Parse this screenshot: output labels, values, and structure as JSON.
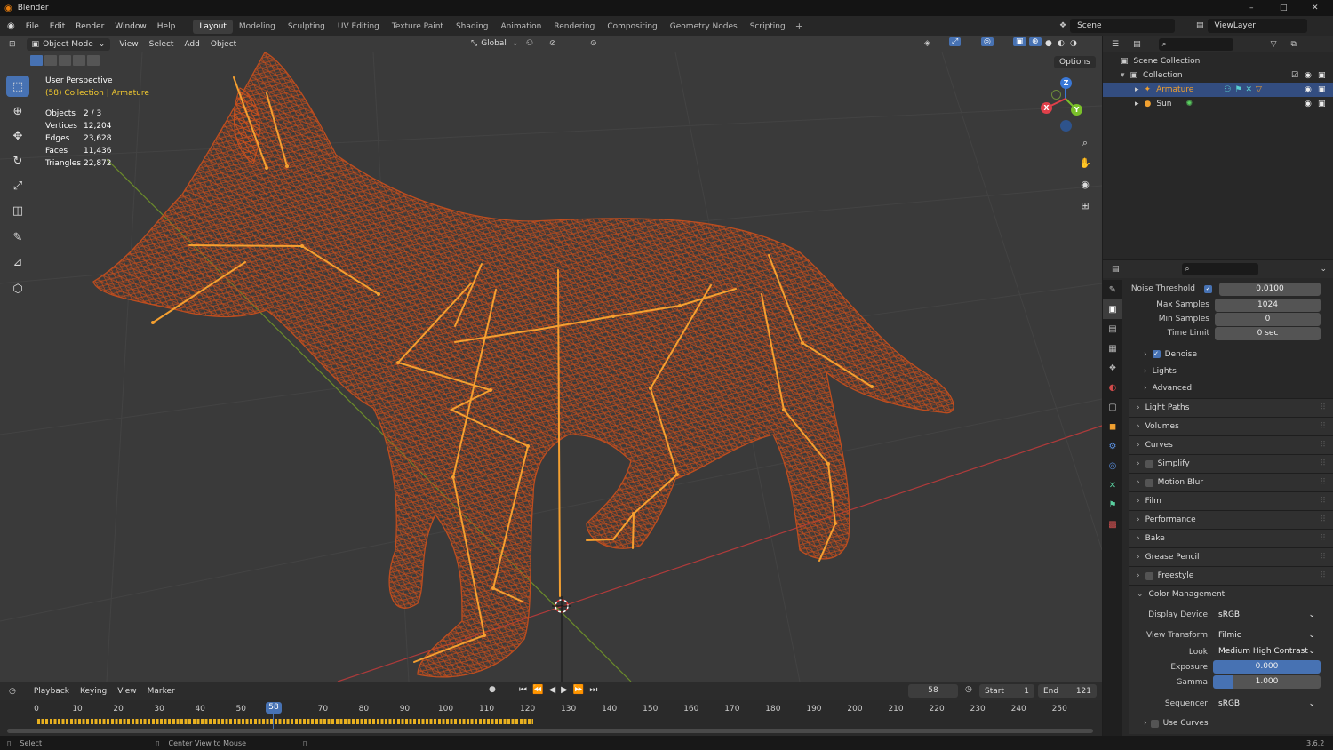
{
  "window": {
    "title": "Blender",
    "minimize": "–",
    "maximize": "□",
    "close": "✕"
  },
  "menu": [
    "File",
    "Edit",
    "Render",
    "Window",
    "Help"
  ],
  "workspaces": [
    "Layout",
    "Modeling",
    "Sculpting",
    "UV Editing",
    "Texture Paint",
    "Shading",
    "Animation",
    "Rendering",
    "Compositing",
    "Geometry Nodes",
    "Scripting"
  ],
  "active_workspace": "Layout",
  "add_workspace": "+",
  "scene": {
    "label": "Scene",
    "view_layer": "ViewLayer"
  },
  "viewport_header": {
    "mode": "Object Mode",
    "menus": [
      "View",
      "Select",
      "Add",
      "Object"
    ],
    "orientation": "Global",
    "options": "Options"
  },
  "viewport_info": {
    "perspective": "User Perspective",
    "collection": "(58) Collection | Armature",
    "stats": [
      {
        "label": "Objects",
        "value": "2 / 3"
      },
      {
        "label": "Vertices",
        "value": "12,204"
      },
      {
        "label": "Edges",
        "value": "23,628"
      },
      {
        "label": "Faces",
        "value": "11,436"
      },
      {
        "label": "Triangles",
        "value": "22,872"
      }
    ]
  },
  "gizmo": {
    "z": "Z",
    "y": "Y",
    "x": "X"
  },
  "outliner": {
    "root": "Scene Collection",
    "collection": "Collection",
    "items": [
      {
        "name": "Armature",
        "selected": true
      },
      {
        "name": "Sun",
        "selected": false
      }
    ]
  },
  "properties": {
    "sampling": [
      {
        "label": "Noise Threshold",
        "value": "0.0100",
        "checked": true
      },
      {
        "label": "Max Samples",
        "value": "1024"
      },
      {
        "label": "Min Samples",
        "value": "0"
      },
      {
        "label": "Time Limit",
        "value": "0 sec"
      }
    ],
    "sub_panels": [
      {
        "label": "Denoise",
        "checkbox": true,
        "checked": true
      },
      {
        "label": "Lights",
        "checkbox": false
      },
      {
        "label": "Advanced",
        "checkbox": false
      }
    ],
    "panels": [
      {
        "label": "Light Paths",
        "checkbox": false
      },
      {
        "label": "Volumes",
        "checkbox": false
      },
      {
        "label": "Curves",
        "checkbox": false
      },
      {
        "label": "Simplify",
        "checkbox": true
      },
      {
        "label": "Motion Blur",
        "checkbox": true
      },
      {
        "label": "Film",
        "checkbox": false
      },
      {
        "label": "Performance",
        "checkbox": false
      },
      {
        "label": "Bake",
        "checkbox": false
      },
      {
        "label": "Grease Pencil",
        "checkbox": false
      },
      {
        "label": "Freestyle",
        "checkbox": true
      }
    ],
    "color_management": {
      "title": "Color Management",
      "display_device_label": "Display Device",
      "display_device": "sRGB",
      "view_transform_label": "View Transform",
      "view_transform": "Filmic",
      "look_label": "Look",
      "look": "Medium High Contrast",
      "exposure_label": "Exposure",
      "exposure": "0.000",
      "gamma_label": "Gamma",
      "gamma": "1.000",
      "sequencer_label": "Sequencer",
      "sequencer": "sRGB",
      "use_curves": "Use Curves"
    }
  },
  "timeline": {
    "menus": [
      "Playback",
      "Keying",
      "View",
      "Marker"
    ],
    "current_frame": "58",
    "start_label": "Start",
    "start": "1",
    "end_label": "End",
    "end": "121",
    "ticks": [
      "0",
      "10",
      "20",
      "30",
      "40",
      "50",
      "70",
      "80",
      "90",
      "100",
      "110",
      "120",
      "130",
      "140",
      "150",
      "160",
      "170",
      "180",
      "190",
      "200",
      "210",
      "220",
      "230",
      "240",
      "250"
    ],
    "playhead": "58"
  },
  "statusbar": {
    "select": "Select",
    "center": "Center View to Mouse",
    "version": "3.6.2"
  },
  "colors": {
    "accent": "#4772b3",
    "wire": "#c8501e",
    "bone": "#f5a030"
  }
}
